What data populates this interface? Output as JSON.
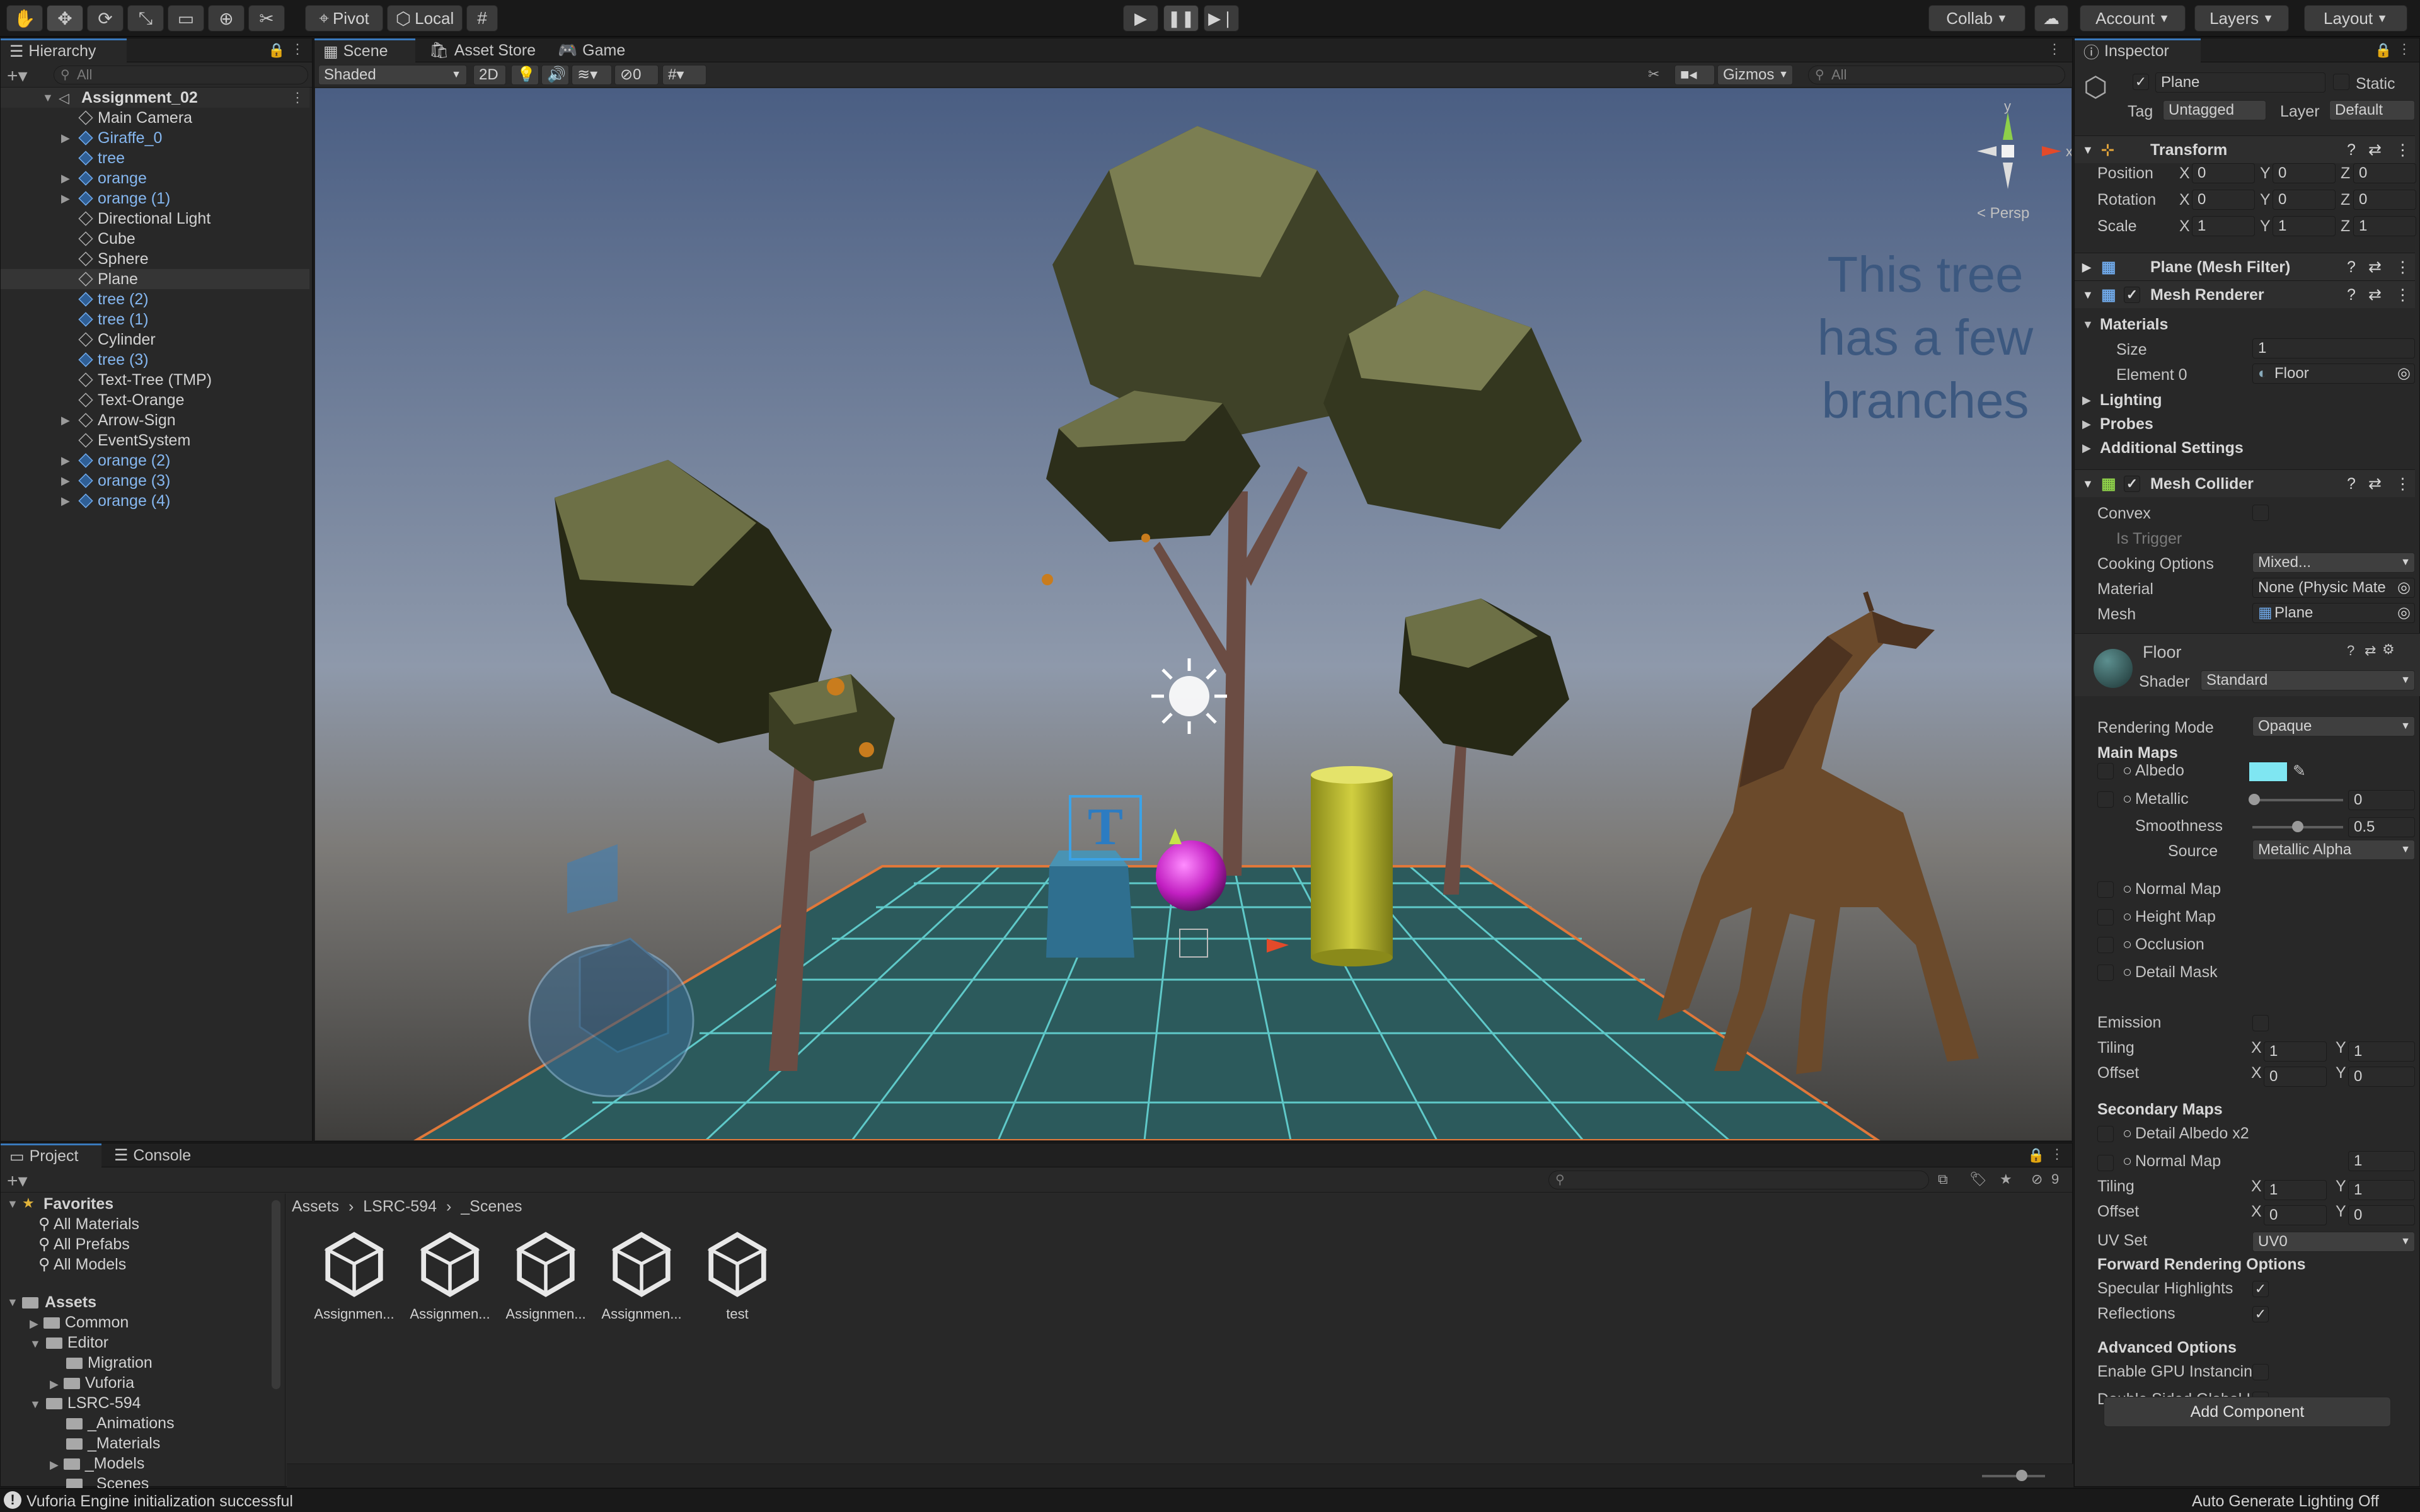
{
  "toolbar": {
    "tools": [
      {
        "name": "hand-tool-icon",
        "glyph": "✋"
      },
      {
        "name": "move-tool-icon",
        "glyph": "✥"
      },
      {
        "name": "rotate-tool-icon",
        "glyph": "⟳"
      },
      {
        "name": "scale-tool-icon",
        "glyph": "⤡"
      },
      {
        "name": "rect-tool-icon",
        "glyph": "▭"
      },
      {
        "name": "transform-tool-icon",
        "glyph": "⊕"
      },
      {
        "name": "custom-tool-icon",
        "glyph": "✂"
      }
    ],
    "pivot": "Pivot",
    "local": "Local",
    "collab": "Collab",
    "account": "Account",
    "layers": "Layers",
    "layout": "Layout"
  },
  "hierarchy": {
    "tab": "Hierarchy",
    "search_placeholder": "All",
    "scene_name": "Assignment_02",
    "items": [
      {
        "label": "Main Camera",
        "prefab": false,
        "expand": false
      },
      {
        "label": "Giraffe_0",
        "prefab": true,
        "expand": true
      },
      {
        "label": "tree",
        "prefab": true,
        "expand": false
      },
      {
        "label": "orange",
        "prefab": true,
        "expand": true
      },
      {
        "label": "orange (1)",
        "prefab": true,
        "expand": true
      },
      {
        "label": "Directional Light",
        "prefab": false,
        "expand": false
      },
      {
        "label": "Cube",
        "prefab": false,
        "expand": false
      },
      {
        "label": "Sphere",
        "prefab": false,
        "expand": false
      },
      {
        "label": "Plane",
        "prefab": false,
        "expand": false,
        "selected": true
      },
      {
        "label": "tree (2)",
        "prefab": true,
        "expand": false
      },
      {
        "label": "tree (1)",
        "prefab": true,
        "expand": false
      },
      {
        "label": "Cylinder",
        "prefab": false,
        "expand": false
      },
      {
        "label": "tree (3)",
        "prefab": true,
        "expand": false
      },
      {
        "label": "Text-Tree (TMP)",
        "prefab": false,
        "expand": false
      },
      {
        "label": "Text-Orange",
        "prefab": false,
        "expand": false
      },
      {
        "label": "Arrow-Sign",
        "prefab": false,
        "expand": true
      },
      {
        "label": "EventSystem",
        "prefab": false,
        "expand": false
      },
      {
        "label": "orange (2)",
        "prefab": true,
        "expand": true
      },
      {
        "label": "orange (3)",
        "prefab": true,
        "expand": true
      },
      {
        "label": "orange (4)",
        "prefab": true,
        "expand": true
      }
    ]
  },
  "scene": {
    "tabs": [
      "Scene",
      "Asset Store",
      "Game"
    ],
    "shading": "Shaded",
    "mode_2d": "2D",
    "hidden_count": "0",
    "gizmos": "Gizmos",
    "search_placeholder": "All",
    "persp": "< Persp",
    "world_text": "This tree\nhas a few\nbranches",
    "gizmo_axes": {
      "x": "x",
      "y": "y"
    },
    "marker_letter": "T"
  },
  "inspector": {
    "tab": "Inspector",
    "object_name": "Plane",
    "static_label": "Static",
    "tag_label": "Tag",
    "tag_value": "Untagged",
    "layer_label": "Layer",
    "layer_value": "Default",
    "transform": {
      "title": "Transform",
      "position": {
        "label": "Position",
        "x": "0",
        "y": "0",
        "z": "0"
      },
      "rotation": {
        "label": "Rotation",
        "x": "0",
        "y": "0",
        "z": "0"
      },
      "scale": {
        "label": "Scale",
        "x": "1",
        "y": "1",
        "z": "1"
      }
    },
    "mesh_filter": "Plane (Mesh Filter)",
    "mesh_renderer": {
      "title": "Mesh Renderer",
      "materials": "Materials",
      "size_label": "Size",
      "size": "1",
      "element0_label": "Element 0",
      "element0": "Floor",
      "lighting": "Lighting",
      "probes": "Probes",
      "additional": "Additional Settings"
    },
    "mesh_collider": {
      "title": "Mesh Collider",
      "convex": "Convex",
      "is_trigger": "Is Trigger",
      "cooking_label": "Cooking Options",
      "cooking": "Mixed...",
      "material_label": "Material",
      "material": "None (Physic Mate",
      "mesh_label": "Mesh",
      "mesh": "Plane"
    },
    "material": {
      "name": "Floor",
      "shader_label": "Shader",
      "shader": "Standard",
      "rendering_mode_label": "Rendering Mode",
      "rendering_mode": "Opaque",
      "main_maps": "Main Maps",
      "albedo": "Albedo",
      "albedo_color": "#7fe6f2",
      "metallic": "Metallic",
      "metallic_value": "0",
      "smoothness": "Smoothness",
      "smoothness_value": "0.5",
      "source_label": "Source",
      "source": "Metallic Alpha",
      "normal_map": "Normal Map",
      "height_map": "Height Map",
      "occlusion": "Occlusion",
      "detail_mask": "Detail Mask",
      "emission": "Emission",
      "tiling": "Tiling",
      "tiling_x": "1",
      "tiling_y": "1",
      "offset": "Offset",
      "offset_x": "0",
      "offset_y": "0",
      "secondary_maps": "Secondary Maps",
      "detail_albedo": "Detail Albedo x2",
      "sec_normal_map": "Normal Map",
      "sec_normal_value": "1",
      "sec_tiling_x": "1",
      "sec_tiling_y": "1",
      "sec_offset_x": "0",
      "sec_offset_y": "0",
      "uv_set_label": "UV Set",
      "uv_set": "UV0",
      "forward": "Forward Rendering Options",
      "specular": "Specular Highlights",
      "reflections": "Reflections",
      "advanced": "Advanced Options",
      "gpu": "Enable GPU Instancin",
      "double_sided": "Double Sided Global I"
    },
    "add_component": "Add Component"
  },
  "project": {
    "tabs": [
      "Project",
      "Console"
    ],
    "hidden_count": "9",
    "favorites": "Favorites",
    "fav_items": [
      "All Materials",
      "All Prefabs",
      "All Models"
    ],
    "assets_label": "Assets",
    "tree": [
      {
        "label": "Common",
        "depth": 1,
        "expand": "right"
      },
      {
        "label": "Editor",
        "depth": 1,
        "expand": "down"
      },
      {
        "label": "Migration",
        "depth": 2,
        "expand": ""
      },
      {
        "label": "Vuforia",
        "depth": 2,
        "expand": "right"
      },
      {
        "label": "LSRC-594",
        "depth": 1,
        "expand": "down"
      },
      {
        "label": "_Animations",
        "depth": 2,
        "expand": ""
      },
      {
        "label": "_Materials",
        "depth": 2,
        "expand": ""
      },
      {
        "label": "_Models",
        "depth": 2,
        "expand": "right"
      },
      {
        "label": "_Scenes",
        "depth": 2,
        "expand": ""
      }
    ],
    "breadcrumb": [
      "Assets",
      "LSRC-594",
      "_Scenes"
    ],
    "files": [
      "Assignmen...",
      "Assignmen...",
      "Assignmen...",
      "Assignmen...",
      "test"
    ]
  },
  "status": {
    "message": "Vuforia Engine initialization successful",
    "lighting": "Auto Generate Lighting Off"
  }
}
